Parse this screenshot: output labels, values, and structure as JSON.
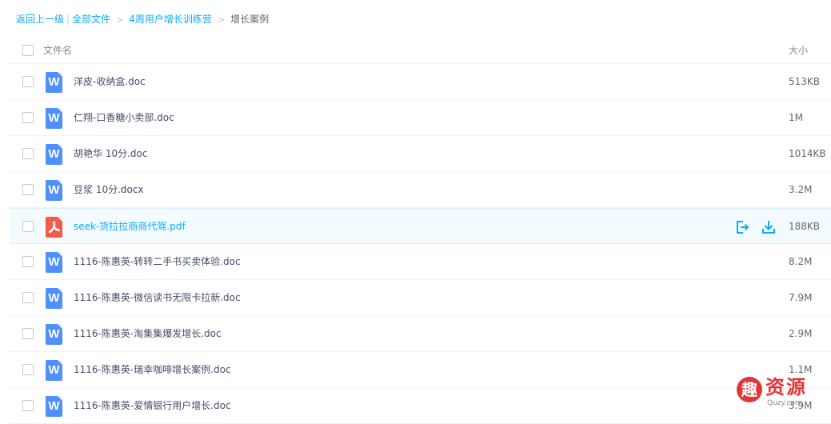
{
  "breadcrumb": {
    "back": "返回上一级",
    "separator": "|",
    "all_files": "全部文件",
    "arrow": ">",
    "folder": "4周用户增长训练营",
    "current": "增长案例"
  },
  "header": {
    "name_label": "文件名",
    "size_label": "大小"
  },
  "files": [
    {
      "name": "洋皮-收纳盒.doc",
      "size": "513KB",
      "type": "doc",
      "icon_letter": "W"
    },
    {
      "name": "仁翔-口香糖小卖部.doc",
      "size": "1M",
      "type": "doc",
      "icon_letter": "W"
    },
    {
      "name": "胡艳华 10分.doc",
      "size": "1014KB",
      "type": "doc",
      "icon_letter": "W"
    },
    {
      "name": "豆浆 10分.docx",
      "size": "3.2M",
      "type": "doc",
      "icon_letter": "W"
    },
    {
      "name": "seek-货拉拉商商代驾.pdf",
      "size": "188KB",
      "type": "pdf",
      "icon_letter": ""
    },
    {
      "name": "1116-陈惠英-转转二手书买卖体验.doc",
      "size": "8.2M",
      "type": "doc",
      "icon_letter": "W"
    },
    {
      "name": "1116-陈惠英-微信读书无限卡拉新.doc",
      "size": "7.9M",
      "type": "doc",
      "icon_letter": "W"
    },
    {
      "name": "1116-陈惠英-淘集集爆发增长.doc",
      "size": "2.9M",
      "type": "doc",
      "icon_letter": "W"
    },
    {
      "name": "1116-陈惠英-瑞幸咖啡增长案例.doc",
      "size": "1.1M",
      "type": "doc",
      "icon_letter": "W"
    },
    {
      "name": "1116-陈惠英-爱情银行用户增长.doc",
      "size": "3.9M",
      "type": "doc",
      "icon_letter": "W"
    }
  ],
  "hover_row_index": 4,
  "icons": {
    "doc": "word-file-icon",
    "pdf": "pdf-file-icon",
    "share": "share-icon",
    "download": "download-icon"
  },
  "colors": {
    "link": "#09aaff",
    "doc_icon": "#4d90fe",
    "pdf_icon": "#f25a4a",
    "hover_bg": "#f4fbff",
    "watermark": "#e03636"
  },
  "watermark": {
    "glyph": "趣",
    "text": "资源",
    "sub": "Quzy.com"
  }
}
